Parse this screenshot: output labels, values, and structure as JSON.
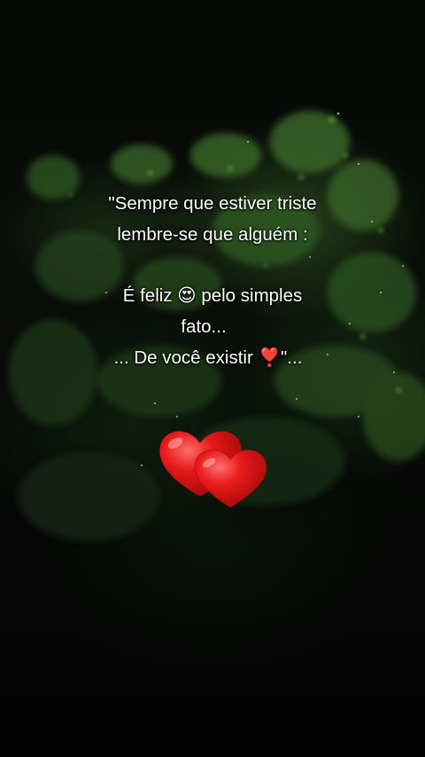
{
  "quote": {
    "line1": "\"Sempre que estiver triste",
    "line2": "lembre-se que alguém :",
    "line3": "É feliz 😍 pelo simples",
    "line4": "fato...",
    "line5": "... De você existir ❣️\"..."
  },
  "colors": {
    "text": "#ffffff",
    "heart": "#e01010",
    "foliage": "#3d6e2a"
  }
}
